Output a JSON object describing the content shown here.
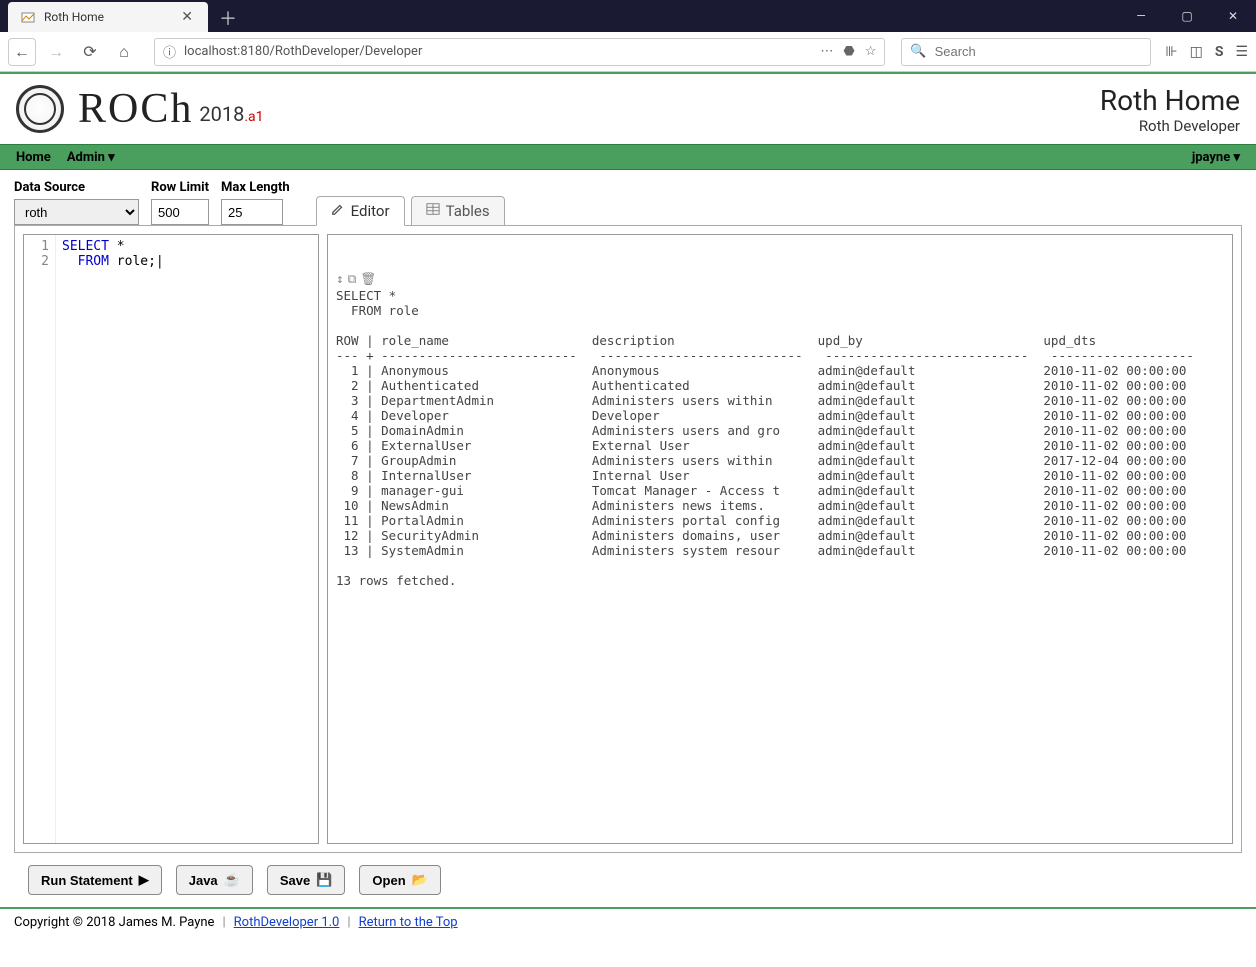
{
  "browser": {
    "tab_title": "Roth Home",
    "url": "localhost:8180/RothDeveloper/Developer",
    "search_placeholder": "Search"
  },
  "header": {
    "brand": "ROCh",
    "version": "2018",
    "version_suffix": ".a1",
    "page_title": "Roth Home",
    "subtitle": "Roth Developer"
  },
  "menubar": {
    "home": "Home",
    "admin": "Admin ▾",
    "user": "jpayne ▾"
  },
  "controls": {
    "datasource_label": "Data Source",
    "datasource_value": "roth",
    "rowlimit_label": "Row Limit",
    "rowlimit_value": "500",
    "maxlength_label": "Max Length",
    "maxlength_value": "25"
  },
  "tabs": {
    "editor": "Editor",
    "tables": "Tables"
  },
  "editor": {
    "line1": "SELECT *",
    "line2": "  FROM role;"
  },
  "result": {
    "header": "SELECT *\n  FROM role\n",
    "columns": "ROW | role_name                   description                   upd_by                        upd_dts",
    "divider": "--- + --------------------------   ---------------------------   ---------------------------   -------------------",
    "rows": [
      "  1 | Anonymous                   Anonymous                     admin@default                 2010-11-02 00:00:00",
      "  2 | Authenticated               Authenticated                 admin@default                 2010-11-02 00:00:00",
      "  3 | DepartmentAdmin             Administers users within      admin@default                 2010-11-02 00:00:00",
      "  4 | Developer                   Developer                     admin@default                 2010-11-02 00:00:00",
      "  5 | DomainAdmin                 Administers users and gro     admin@default                 2010-11-02 00:00:00",
      "  6 | ExternalUser                External User                 admin@default                 2010-11-02 00:00:00",
      "  7 | GroupAdmin                  Administers users within      admin@default                 2017-12-04 00:00:00",
      "  8 | InternalUser                Internal User                 admin@default                 2010-11-02 00:00:00",
      "  9 | manager-gui                 Tomcat Manager - Access t     admin@default                 2010-11-02 00:00:00",
      " 10 | NewsAdmin                   Administers news items.       admin@default                 2010-11-02 00:00:00",
      " 11 | PortalAdmin                 Administers portal config     admin@default                 2010-11-02 00:00:00",
      " 12 | SecurityAdmin               Administers domains, user     admin@default                 2010-11-02 00:00:00",
      " 13 | SystemAdmin                 Administers system resour     admin@default                 2010-11-02 00:00:00"
    ],
    "footer": "13 rows fetched."
  },
  "buttons": {
    "run": "Run Statement",
    "java": "Java",
    "save": "Save",
    "open": "Open"
  },
  "footer": {
    "copyright": "Copyright © 2018 James M. Payne",
    "link1": "RothDeveloper 1.0",
    "link2": "Return to the Top"
  },
  "chart_data": {
    "type": "table",
    "title": "role",
    "columns": [
      "ROW",
      "role_name",
      "description",
      "upd_by",
      "upd_dts"
    ],
    "rows": [
      [
        1,
        "Anonymous",
        "Anonymous",
        "admin@default",
        "2010-11-02 00:00:00"
      ],
      [
        2,
        "Authenticated",
        "Authenticated",
        "admin@default",
        "2010-11-02 00:00:00"
      ],
      [
        3,
        "DepartmentAdmin",
        "Administers users within",
        "admin@default",
        "2010-11-02 00:00:00"
      ],
      [
        4,
        "Developer",
        "Developer",
        "admin@default",
        "2010-11-02 00:00:00"
      ],
      [
        5,
        "DomainAdmin",
        "Administers users and gro",
        "admin@default",
        "2010-11-02 00:00:00"
      ],
      [
        6,
        "ExternalUser",
        "External User",
        "admin@default",
        "2010-11-02 00:00:00"
      ],
      [
        7,
        "GroupAdmin",
        "Administers users within",
        "admin@default",
        "2017-12-04 00:00:00"
      ],
      [
        8,
        "InternalUser",
        "Internal User",
        "admin@default",
        "2010-11-02 00:00:00"
      ],
      [
        9,
        "manager-gui",
        "Tomcat Manager - Access t",
        "admin@default",
        "2010-11-02 00:00:00"
      ],
      [
        10,
        "NewsAdmin",
        "Administers news items.",
        "admin@default",
        "2010-11-02 00:00:00"
      ],
      [
        11,
        "PortalAdmin",
        "Administers portal config",
        "admin@default",
        "2010-11-02 00:00:00"
      ],
      [
        12,
        "SecurityAdmin",
        "Administers domains, user",
        "admin@default",
        "2010-11-02 00:00:00"
      ],
      [
        13,
        "SystemAdmin",
        "Administers system resour",
        "admin@default",
        "2010-11-02 00:00:00"
      ]
    ]
  }
}
